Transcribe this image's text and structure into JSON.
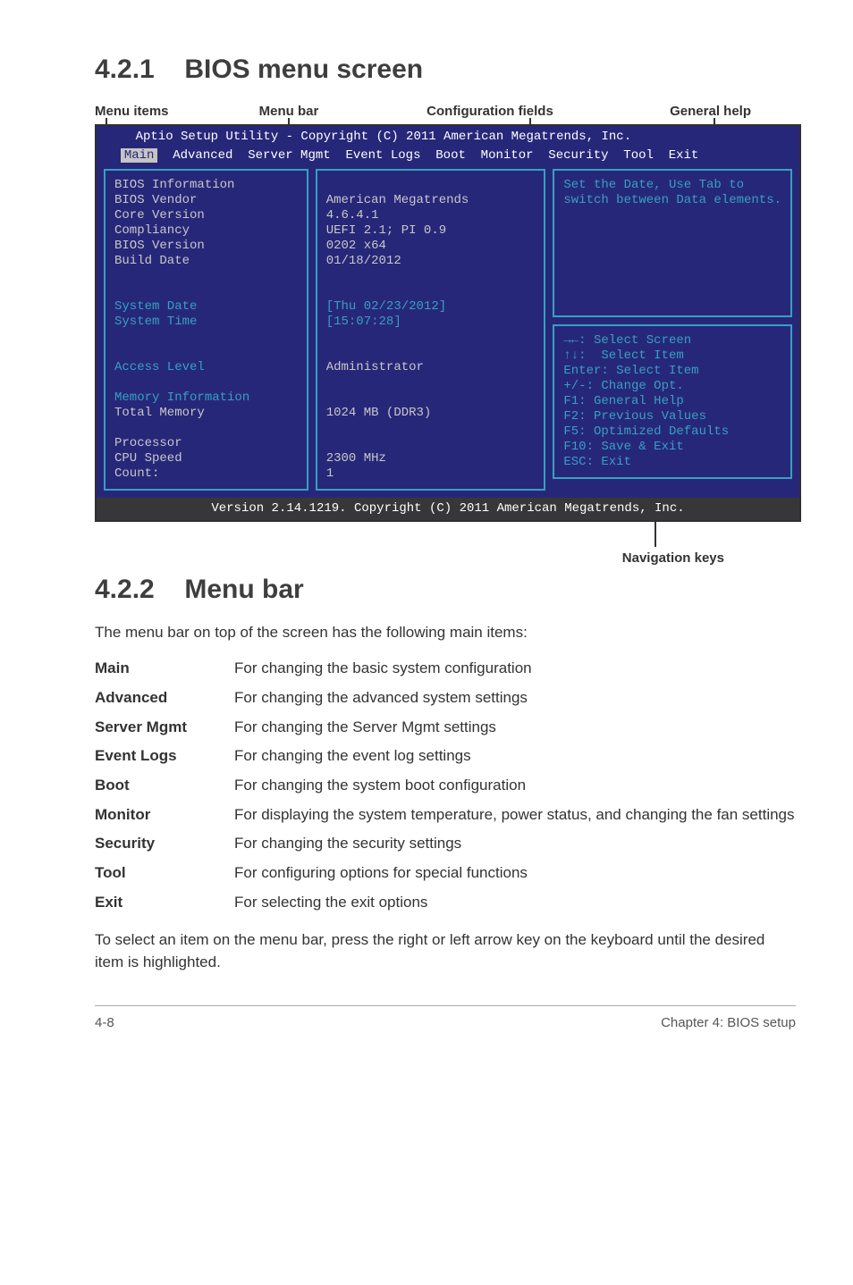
{
  "sec1": {
    "num": "4.2.1",
    "title": "BIOS menu screen"
  },
  "legend": {
    "l1": "Menu items",
    "l2": "Menu bar",
    "l3": "Configuration fields",
    "l4": "General help"
  },
  "bios": {
    "header": "    Aptio Setup Utility - Copyright (C) 2011 American Megatrends, Inc.",
    "menu": {
      "sel": "Main",
      "rest": "  Advanced  Server Mgmt  Event Logs  Boot  Monitor  Security  Tool  Exit"
    },
    "left": "BIOS Information\nBIOS Vendor\nCore Version\nCompliancy\nBIOS Version\nBuild Date\n\n\nSystem Date\nSystem Time\n\n\nAccess Level\n\nMemory Information\nTotal Memory\n\nProcessor\nCPU Speed\nCount:",
    "left_blue_lines": [
      "System Date",
      "System Time",
      "Access Level",
      "Memory Information"
    ],
    "mid": "\nAmerican Megatrends\n4.6.4.1\nUEFI 2.1; PI 0.9\n0202 x64\n01/18/2012\n\n\n[Thu 02/23/2012]\n[15:07:28]\n\n\nAdministrator\n\n\n1024 MB (DDR3)\n\n\n2300 MHz\n1",
    "mid_blue_lines": [
      "[Thu 02/23/2012]",
      "[15:07:28]"
    ],
    "rtop": "Set the Date, Use Tab to\nswitch between Data elements.",
    "rbot": "→←: Select Screen\n↑↓:  Select Item\nEnter: Select Item\n+/-: Change Opt.\nF1: General Help\nF2: Previous Values\nF5: Optimized Defaults\nF10: Save & Exit\nESC: Exit",
    "footer": "Version 2.14.1219. Copyright (C) 2011 American Megatrends, Inc."
  },
  "navkeys": "Navigation keys",
  "sec2": {
    "num": "4.2.2",
    "title": "Menu bar"
  },
  "intro2": "The menu bar on top of the screen has the following main items:",
  "defs": [
    {
      "k": "Main",
      "v": "For changing the basic system configuration"
    },
    {
      "k": "Advanced",
      "v": "For changing the advanced system settings"
    },
    {
      "k": "Server Mgmt",
      "v": "For changing the Server Mgmt settings"
    },
    {
      "k": "Event Logs",
      "v": "For changing the event log settings"
    },
    {
      "k": "Boot",
      "v": "For changing the system boot configuration"
    },
    {
      "k": "Monitor",
      "v": "For displaying the system temperature, power status, and changing the fan settings"
    },
    {
      "k": "Security",
      "v": "For changing the security settings"
    },
    {
      "k": "Tool",
      "v": "For configuring options for special functions"
    },
    {
      "k": "Exit",
      "v": "For selecting the exit options"
    }
  ],
  "tail2": "To select an item on the menu bar, press the right or left arrow key on the keyboard until the desired item is highlighted.",
  "footer": {
    "left": "4-8",
    "right": "Chapter 4: BIOS setup"
  },
  "chart_data": {
    "type": "table",
    "title": "BIOS Information (Main)",
    "rows": [
      {
        "field": "BIOS Vendor",
        "value": "American Megatrends"
      },
      {
        "field": "Core Version",
        "value": "4.6.4.1"
      },
      {
        "field": "Compliancy",
        "value": "UEFI 2.1; PI 0.9"
      },
      {
        "field": "BIOS Version",
        "value": "0202 x64"
      },
      {
        "field": "Build Date",
        "value": "01/18/2012"
      },
      {
        "field": "System Date",
        "value": "Thu 02/23/2012"
      },
      {
        "field": "System Time",
        "value": "15:07:28"
      },
      {
        "field": "Access Level",
        "value": "Administrator"
      },
      {
        "field": "Total Memory",
        "value": "1024 MB (DDR3)"
      },
      {
        "field": "CPU Speed",
        "value": "2300 MHz"
      },
      {
        "field": "Count",
        "value": "1"
      }
    ]
  }
}
